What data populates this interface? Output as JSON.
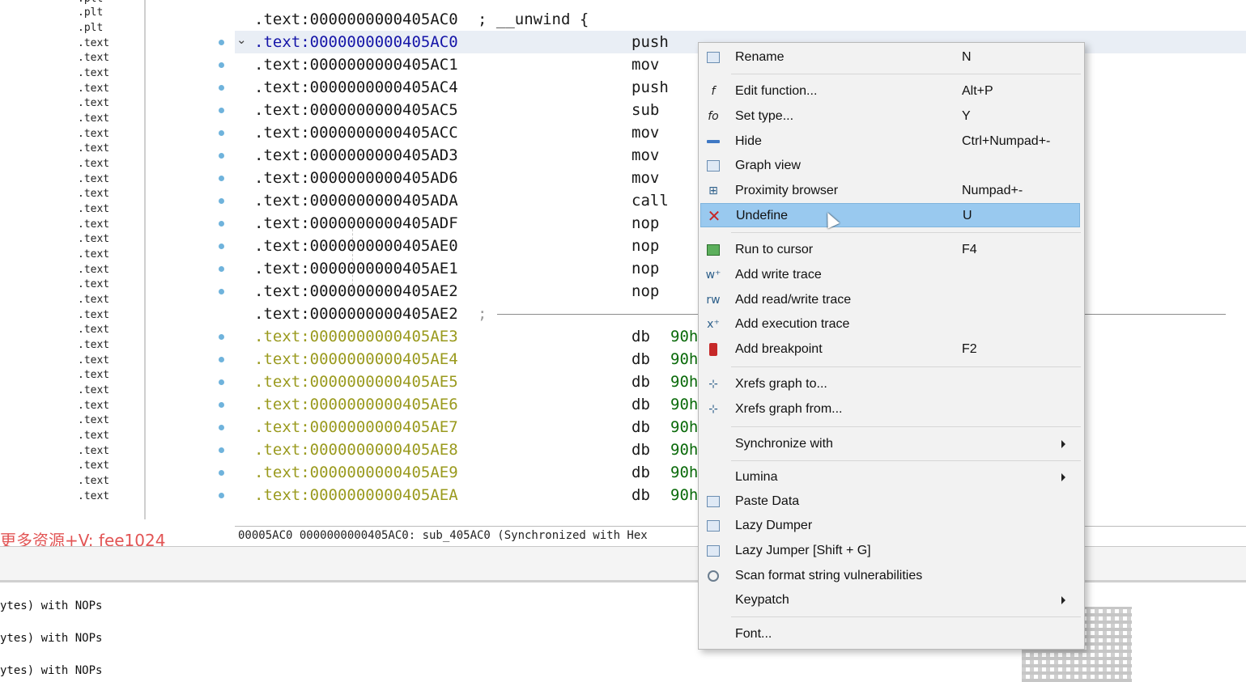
{
  "segments": [
    ".plt",
    ".plt",
    ".plt",
    ".text",
    ".text",
    ".text",
    ".text",
    ".text",
    ".text",
    ".text",
    ".text",
    ".text",
    ".text",
    ".text",
    ".text",
    ".text",
    ".text",
    ".text",
    ".text",
    ".text",
    ".text",
    ".text",
    ".text",
    ".text",
    ".text",
    ".text",
    ".text",
    ".text",
    ".text",
    ".text",
    ".text",
    ".text",
    ".text",
    ".text"
  ],
  "disasm": {
    "rows": [
      {
        "addr": ".text:0000000000405AC0",
        "color": "black",
        "mn": "",
        "op": "",
        "comment": "; __unwind {",
        "dot": false,
        "chev": false
      },
      {
        "addr": ".text:0000000000405AC0",
        "color": "blue",
        "mn": "push",
        "op": "",
        "comment": "",
        "dot": true,
        "chev": true
      },
      {
        "addr": ".text:0000000000405AC1",
        "color": "black",
        "mn": "mov",
        "op": "",
        "comment": "",
        "dot": true,
        "chev": false
      },
      {
        "addr": ".text:0000000000405AC4",
        "color": "black",
        "mn": "push",
        "op": "",
        "comment": "",
        "dot": true,
        "chev": false
      },
      {
        "addr": ".text:0000000000405AC5",
        "color": "black",
        "mn": "sub",
        "op": "",
        "comment": "",
        "dot": true,
        "chev": false
      },
      {
        "addr": ".text:0000000000405ACC",
        "color": "black",
        "mn": "mov",
        "op": "",
        "comment": "",
        "dot": true,
        "chev": false
      },
      {
        "addr": ".text:0000000000405AD3",
        "color": "black",
        "mn": "mov",
        "op": "",
        "comment": "",
        "dot": true,
        "chev": false
      },
      {
        "addr": ".text:0000000000405AD6",
        "color": "black",
        "mn": "mov",
        "op": "",
        "comment": "",
        "dot": true,
        "chev": false
      },
      {
        "addr": ".text:0000000000405ADA",
        "color": "black",
        "mn": "call",
        "op": "",
        "comment": "",
        "dot": true,
        "chev": false
      },
      {
        "addr": ".text:0000000000405ADF",
        "color": "black",
        "mn": "nop",
        "op": "",
        "comment": "",
        "dot": true,
        "chev": false
      },
      {
        "addr": ".text:0000000000405AE0",
        "color": "black",
        "mn": "nop",
        "op": "",
        "comment": "",
        "dot": true,
        "chev": false
      },
      {
        "addr": ".text:0000000000405AE1",
        "color": "black",
        "mn": "nop",
        "op": "",
        "comment": "",
        "dot": true,
        "chev": false
      },
      {
        "addr": ".text:0000000000405AE2",
        "color": "black",
        "mn": "nop",
        "op": "",
        "comment": "",
        "dot": true,
        "chev": false
      },
      {
        "addr": ".text:0000000000405AE2",
        "color": "black",
        "mn": "",
        "op": "",
        "comment": ";",
        "dot": false,
        "chev": false
      },
      {
        "addr": ".text:0000000000405AE3",
        "color": "olive",
        "mn": "db",
        "op": "90h",
        "comment": "",
        "dot": true,
        "chev": false
      },
      {
        "addr": ".text:0000000000405AE4",
        "color": "olive",
        "mn": "db",
        "op": "90h",
        "comment": "",
        "dot": true,
        "chev": false
      },
      {
        "addr": ".text:0000000000405AE5",
        "color": "olive",
        "mn": "db",
        "op": "90h",
        "comment": "",
        "dot": true,
        "chev": false
      },
      {
        "addr": ".text:0000000000405AE6",
        "color": "olive",
        "mn": "db",
        "op": "90h",
        "comment": "",
        "dot": true,
        "chev": false
      },
      {
        "addr": ".text:0000000000405AE7",
        "color": "olive",
        "mn": "db",
        "op": "90h",
        "comment": "",
        "dot": true,
        "chev": false
      },
      {
        "addr": ".text:0000000000405AE8",
        "color": "olive",
        "mn": "db",
        "op": "90h",
        "comment": "",
        "dot": true,
        "chev": false
      },
      {
        "addr": ".text:0000000000405AE9",
        "color": "olive",
        "mn": "db",
        "op": "90h",
        "comment": "",
        "dot": true,
        "chev": false
      },
      {
        "addr": ".text:0000000000405AEA",
        "color": "olive",
        "mn": "db",
        "op": "90h",
        "comment": "",
        "dot": true,
        "chev": false
      }
    ],
    "status": "00005AC0 0000000000405AC0: sub_405AC0 (Synchronized with Hex"
  },
  "watermark": "更多资源+V: fee1024",
  "output_lines": [
    "ytes) with NOPs",
    "ytes) with NOPs",
    "ytes) with NOPs"
  ],
  "context_menu": {
    "items": [
      {
        "label": "Rename",
        "shortcut": "N",
        "icon": "rename-icon"
      },
      {
        "label": "Edit function...",
        "shortcut": "Alt+P",
        "icon": "function-icon"
      },
      {
        "label": "Set type...",
        "shortcut": "Y",
        "icon": "set-type-icon"
      },
      {
        "label": "Hide",
        "shortcut": "Ctrl+Numpad+-",
        "icon": "hide-icon"
      },
      {
        "label": "Graph view",
        "shortcut": "",
        "icon": "graph-view-icon"
      },
      {
        "label": "Proximity browser",
        "shortcut": "Numpad+-",
        "icon": "proximity-icon"
      },
      {
        "label": "Undefine",
        "shortcut": "U",
        "icon": "undefine-x-icon"
      },
      {
        "label": "Run to cursor",
        "shortcut": "F4",
        "icon": "run-to-cursor-icon"
      },
      {
        "label": "Add write trace",
        "shortcut": "",
        "icon": "write-trace-icon"
      },
      {
        "label": "Add read/write trace",
        "shortcut": "",
        "icon": "read-write-trace-icon"
      },
      {
        "label": "Add execution trace",
        "shortcut": "",
        "icon": "execution-trace-icon"
      },
      {
        "label": "Add breakpoint",
        "shortcut": "F2",
        "icon": "breakpoint-icon"
      },
      {
        "label": "Xrefs graph to...",
        "shortcut": "",
        "icon": "xrefs-to-icon"
      },
      {
        "label": "Xrefs graph from...",
        "shortcut": "",
        "icon": "xrefs-from-icon"
      },
      {
        "label": "Synchronize with",
        "shortcut": "",
        "icon": ""
      },
      {
        "label": "Lumina",
        "shortcut": "",
        "icon": ""
      },
      {
        "label": "Paste Data",
        "shortcut": "",
        "icon": "plugin-icon"
      },
      {
        "label": "Lazy Dumper",
        "shortcut": "",
        "icon": "plugin-icon"
      },
      {
        "label": "Lazy Jumper [Shift + G]",
        "shortcut": "",
        "icon": "plugin-icon"
      },
      {
        "label": "Scan format string vulnerabilities",
        "shortcut": "",
        "icon": "scan-icon"
      },
      {
        "label": "Keypatch",
        "shortcut": "",
        "icon": ""
      },
      {
        "label": "Font...",
        "shortcut": "",
        "icon": ""
      }
    ],
    "selected": "Undefine"
  },
  "colors": {
    "selection": "#99c9ef",
    "address_blue": "#1515a8",
    "data_olive": "#9a9a1e",
    "dot": "#6fb3dc"
  }
}
